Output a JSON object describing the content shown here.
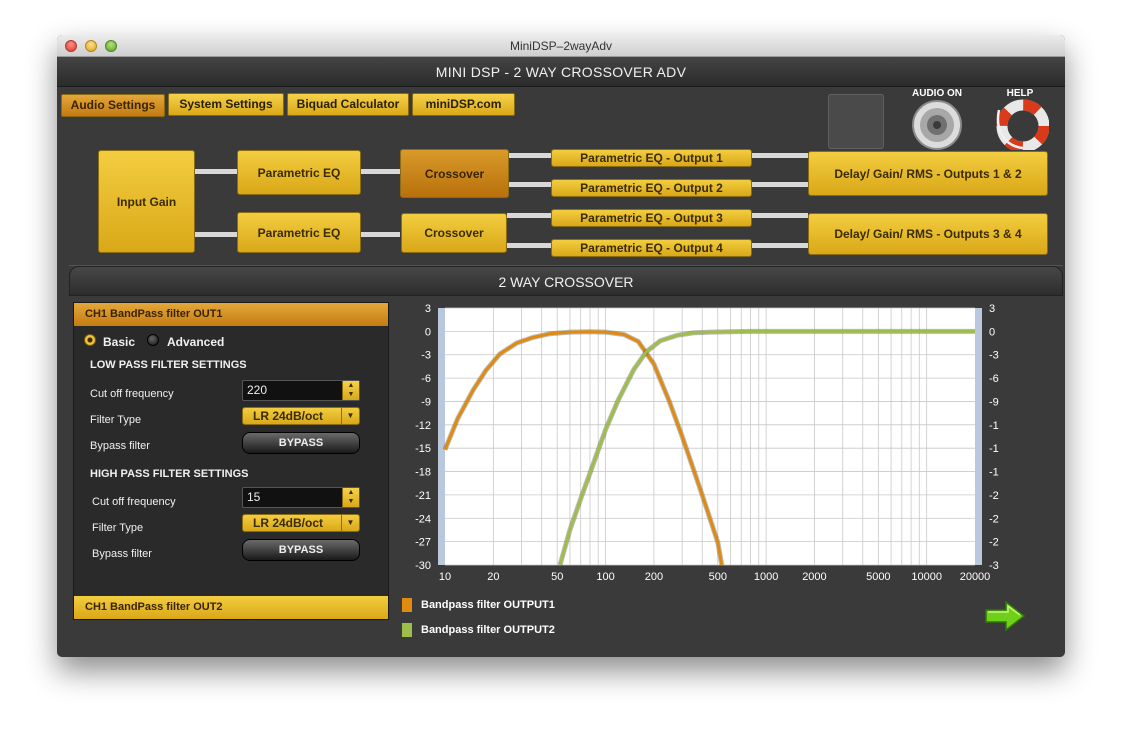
{
  "window": {
    "title": "MiniDSP–2wayAdv"
  },
  "app": {
    "title": "MINI DSP - 2 WAY CROSSOVER ADV"
  },
  "tabs": [
    {
      "label": "Audio Settings"
    },
    {
      "label": "System Settings"
    },
    {
      "label": "Biquad Calculator"
    },
    {
      "label": "miniDSP.com"
    }
  ],
  "icons": {
    "audio_label": "AUDIO ON",
    "help_label": "HELP"
  },
  "diagram": {
    "input_gain": "Input Gain",
    "peq1": "Parametric EQ",
    "peq2": "Parametric EQ",
    "crossover1": "Crossover",
    "crossover2": "Crossover",
    "out1": "Parametric EQ - Output 1",
    "out2": "Parametric EQ - Output 2",
    "out3": "Parametric EQ - Output 3",
    "out4": "Parametric EQ - Output 4",
    "delay12": "Delay/ Gain/ RMS - Outputs 1 & 2",
    "delay34": "Delay/ Gain/ RMS - Outputs 3 & 4"
  },
  "panel": {
    "title": "2 WAY CROSSOVER",
    "ch1_out1": "CH1 BandPass filter OUT1",
    "ch1_out2": "CH1 BandPass filter OUT2",
    "mode_basic": "Basic",
    "mode_advanced": "Advanced",
    "lp": {
      "heading": "LOW PASS FILTER SETTINGS",
      "cutoff_label": "Cut off frequency",
      "cutoff_value": "220",
      "type_label": "Filter Type",
      "type_value": "LR 24dB/oct",
      "bypass_label": "Bypass filter",
      "bypass_button": "BYPASS"
    },
    "hp": {
      "heading": "HIGH PASS FILTER SETTINGS",
      "cutoff_label": "Cut off frequency",
      "cutoff_value": "15",
      "type_label": "Filter Type",
      "type_value": "LR 24dB/oct",
      "bypass_label": "Bypass filter",
      "bypass_button": "BYPASS"
    }
  },
  "colors": {
    "series1": "#e08a10",
    "series2": "#9fbd4a",
    "plot_bg": "#ffffff",
    "accent_yellow": "#e9bd2c"
  },
  "chart_data": {
    "type": "line",
    "xscale": "log",
    "xlim": [
      10,
      20000
    ],
    "ylim": [
      -30,
      3
    ],
    "x_ticks": [
      10,
      20,
      50,
      100,
      200,
      500,
      1000,
      2000,
      5000,
      10000,
      20000
    ],
    "x_tick_labels": [
      "10",
      "20",
      "50",
      "100",
      "200",
      "500",
      "1000",
      "2000",
      "5000",
      "10000",
      "20000"
    ],
    "y_ticks": [
      3,
      0,
      -3,
      -6,
      -9,
      -12,
      -15,
      -18,
      -21,
      -24,
      -27,
      -30
    ],
    "y_tick_labels": [
      "3",
      "0",
      "-3",
      "-6",
      "-9",
      "-12",
      "-15",
      "-18",
      "-21",
      "-24",
      "-27",
      "-30"
    ],
    "series": [
      {
        "name": "Bandpass filter OUTPUT1",
        "x": [
          10,
          12,
          15,
          18,
          22,
          28,
          35,
          45,
          60,
          80,
          100,
          130,
          160,
          200,
          250,
          300,
          350,
          400,
          450,
          500,
          530
        ],
        "y": [
          -15.2,
          -11.2,
          -7.5,
          -5,
          -2.9,
          -1.5,
          -0.8,
          -0.3,
          -0.1,
          -0.05,
          -0.1,
          -0.4,
          -1.3,
          -4.2,
          -9,
          -13.5,
          -17.5,
          -21,
          -24.2,
          -27.1,
          -30
        ]
      },
      {
        "name": "Bandpass filter OUTPUT2",
        "x": [
          52,
          60,
          70,
          80,
          100,
          120,
          150,
          180,
          220,
          280,
          350,
          450,
          600,
          800,
          1000,
          2000,
          5000,
          10000,
          20000
        ],
        "y": [
          -30,
          -25.5,
          -21.5,
          -18.2,
          -12.6,
          -8.8,
          -4.9,
          -2.6,
          -1.2,
          -0.5,
          -0.2,
          -0.1,
          -0.05,
          0,
          0,
          0,
          0,
          0,
          0
        ]
      }
    ]
  }
}
